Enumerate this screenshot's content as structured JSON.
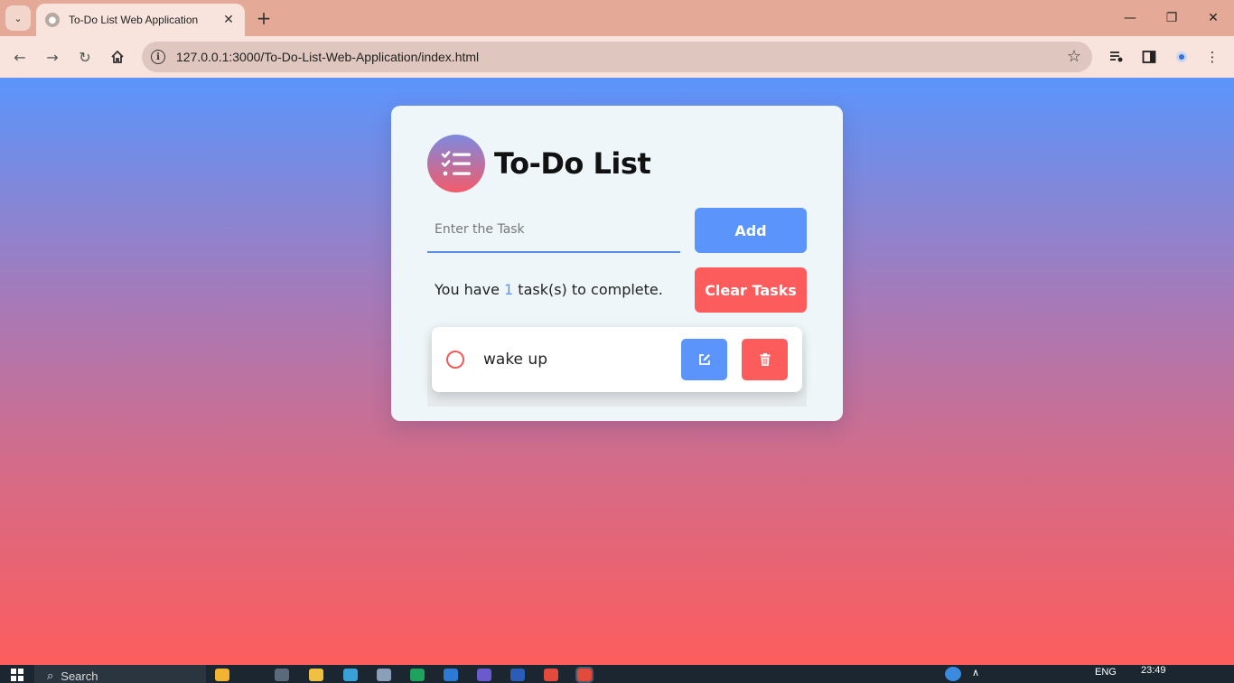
{
  "browser": {
    "tab_title": "To-Do List Web Application",
    "url": "127.0.0.1:3000/To-Do-List-Web-Application/index.html",
    "new_tab_symbol": "+",
    "tab_close_symbol": "✕"
  },
  "app": {
    "title": "To-Do List",
    "input_placeholder": "Enter the Task",
    "input_value": "",
    "add_label": "Add",
    "clear_label": "Clear Tasks",
    "status_prefix": "You have ",
    "task_count": "1",
    "status_suffix": " task(s) to complete.",
    "tasks": [
      {
        "text": "wake up",
        "completed": false
      }
    ]
  },
  "taskbar": {
    "search_label": "Search",
    "language": "ENG",
    "time": "23:49"
  },
  "colors": {
    "primary": "#5b95fc",
    "danger": "#fd5c5c",
    "card_bg": "#eef6f9"
  }
}
